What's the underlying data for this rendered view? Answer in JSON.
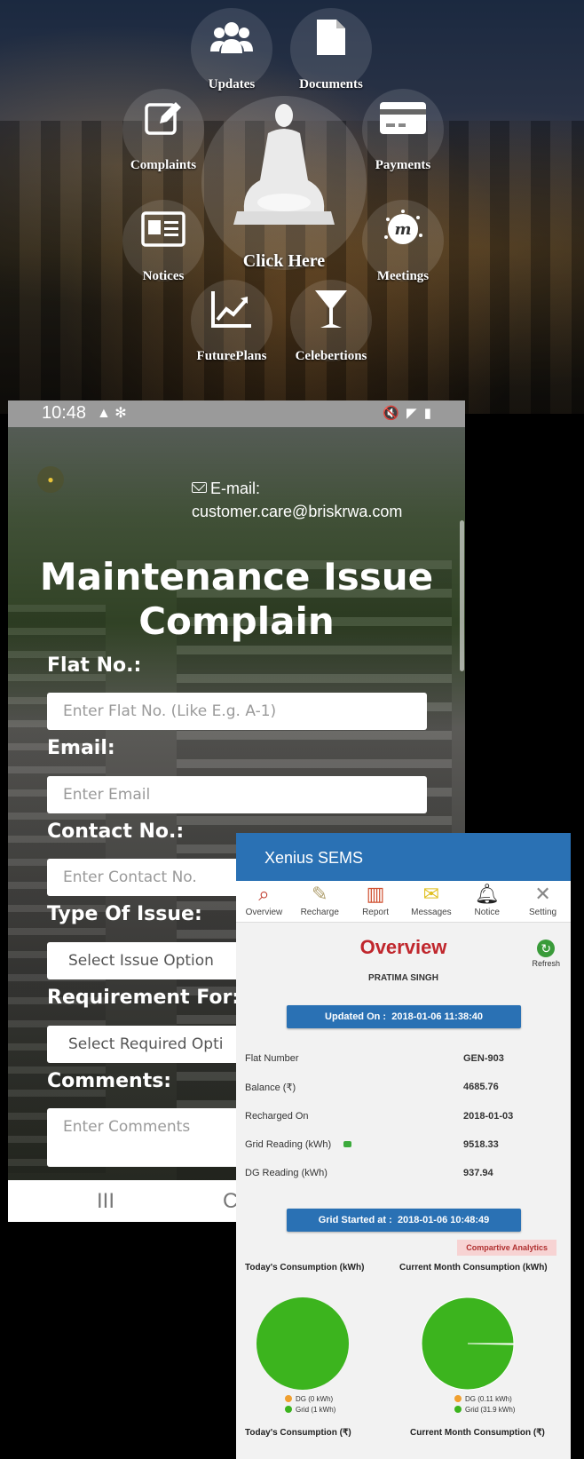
{
  "menu": {
    "updates": "Updates",
    "documents": "Documents",
    "complaints": "Complaints",
    "payments": "Payments",
    "notices": "Notices",
    "meetings": "Meetings",
    "future_plans": "FuturePlans",
    "celebrations": "Celebertions",
    "center": "Click Here"
  },
  "phone": {
    "time": "10:48",
    "email_label": "E-mail:",
    "email": "customer.care@briskrwa.com",
    "title": "Maintenance Issue Complain",
    "fields": {
      "flat_label": "Flat No.:",
      "flat_placeholder": "Enter Flat No. (Like E.g. A-1)",
      "email_label": "Email:",
      "email_placeholder": "Enter Email",
      "contact_label": "Contact No.:",
      "contact_placeholder": "Enter Contact No.",
      "issue_label": "Type Of Issue:",
      "issue_value": "Select Issue Option",
      "req_label": "Requirement For:",
      "req_value": "Select Required Opti",
      "comments_label": "Comments:",
      "comments_placeholder": "Enter Comments"
    },
    "nav_recent": "III",
    "nav_home": "C"
  },
  "sems": {
    "app_title": "Xenius SEMS",
    "tabs": [
      "Overview",
      "Recharge",
      "Report",
      "Messages",
      "Notice",
      "Setting"
    ],
    "heading": "Overview",
    "refresh": "Refresh",
    "user": "PRATIMA SINGH",
    "updated_label": "Updated On :",
    "updated_value": "2018-01-06 11:38:40",
    "rows": [
      {
        "label": "Flat Number",
        "value": "GEN-903"
      },
      {
        "label": "Balance (₹)",
        "value": "4685.76"
      },
      {
        "label": "Recharged On",
        "value": "2018-01-03"
      },
      {
        "label": "Grid Reading (kWh)",
        "value": "9518.33"
      },
      {
        "label": "DG Reading (kWh)",
        "value": "937.94"
      }
    ],
    "grid_started_label": "Grid Started at :",
    "grid_started_value": "2018-01-06 10:48:49",
    "analytics": "Compartive Analytics",
    "today_kwh": "Today's Consumption (kWh)",
    "month_kwh": "Current Month Consumption (kWh)",
    "today_rs": "Today's Consumption (₹)",
    "month_rs": "Current Month Consumption (₹)",
    "colors": {
      "grid": "#3cb41e",
      "dg": "#f0a030"
    },
    "today_legend": {
      "dg": "DG (0 kWh)",
      "grid": "Grid (1 kWh)"
    },
    "month_legend": {
      "dg": "DG (0.11 kWh)",
      "grid": "Grid (31.9 kWh)"
    }
  },
  "chart_data": [
    {
      "type": "pie",
      "title": "Today's Consumption (kWh)",
      "categories": [
        "DG",
        "Grid"
      ],
      "values": [
        0,
        1
      ]
    },
    {
      "type": "pie",
      "title": "Current Month Consumption (kWh)",
      "categories": [
        "DG",
        "Grid"
      ],
      "values": [
        0.11,
        31.9
      ]
    }
  ]
}
